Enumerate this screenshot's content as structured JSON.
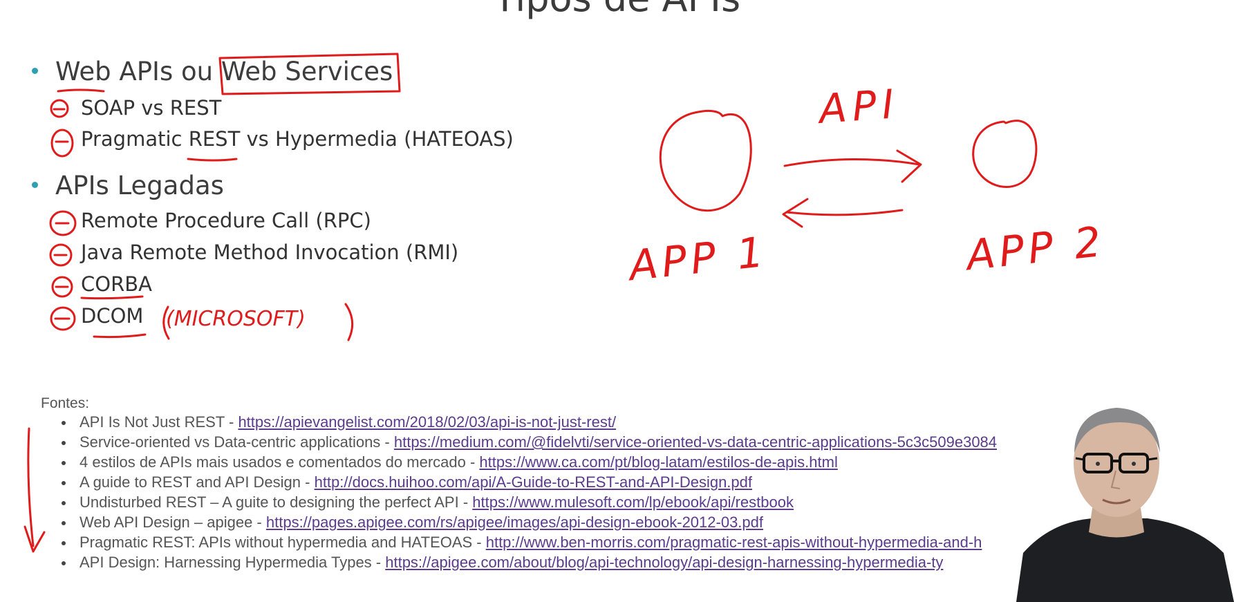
{
  "slide": {
    "title": "Tipos de APIs",
    "sections": [
      {
        "heading": "Web APIs ou Web Services",
        "items": [
          "SOAP vs REST",
          "Pragmatic REST vs Hypermedia (HATEOAS)"
        ]
      },
      {
        "heading": "APIs Legadas",
        "items": [
          "Remote Procedure Call (RPC)",
          "Java Remote Method Invocation (RMI)",
          "CORBA",
          "DCOM"
        ]
      }
    ],
    "sources_label": "Fontes:",
    "sources": [
      {
        "text": "API Is Not Just REST - ",
        "link": "https://apievangelist.com/2018/02/03/api-is-not-just-rest/"
      },
      {
        "text": "Service-oriented vs Data-centric applications - ",
        "link": "https://medium.com/@fidelvti/service-oriented-vs-data-centric-applications-5c3c509e3084"
      },
      {
        "text": "4 estilos de APIs mais usados e comentados do mercado - ",
        "link": "https://www.ca.com/pt/blog-latam/estilos-de-apis.html"
      },
      {
        "text": "A guide to REST and API Design - ",
        "link": "http://docs.huihoo.com/api/A-Guide-to-REST-and-API-Design.pdf"
      },
      {
        "text": "Undisturbed REST – A guite to designing the perfect API - ",
        "link": "https://www.mulesoft.com/lp/ebook/api/restbook"
      },
      {
        "text": "Web API Design – apigee - ",
        "link": "https://pages.apigee.com/rs/apigee/images/api-design-ebook-2012-03.pdf"
      },
      {
        "text": "Pragmatic REST: APIs without hypermedia and HATEOAS - ",
        "link": "http://www.ben-morris.com/pragmatic-rest-apis-without-hypermedia-and-h"
      },
      {
        "text": "API Design: Harnessing Hypermedia Types - ",
        "link": "https://apigee.com/about/blog/api-technology/api-design-harnessing-hypermedia-ty"
      }
    ]
  },
  "annotations": {
    "ink_color": "#e01b1b",
    "diagram_label_api": "API",
    "diagram_label_app1": "APP 1",
    "diagram_label_app2": "APP 2",
    "dcom_note": "(MICROSOFT)"
  },
  "colors": {
    "bullet_accent": "#2fa0b4",
    "link": "#5b3b8c",
    "ink": "#e01b1b"
  }
}
